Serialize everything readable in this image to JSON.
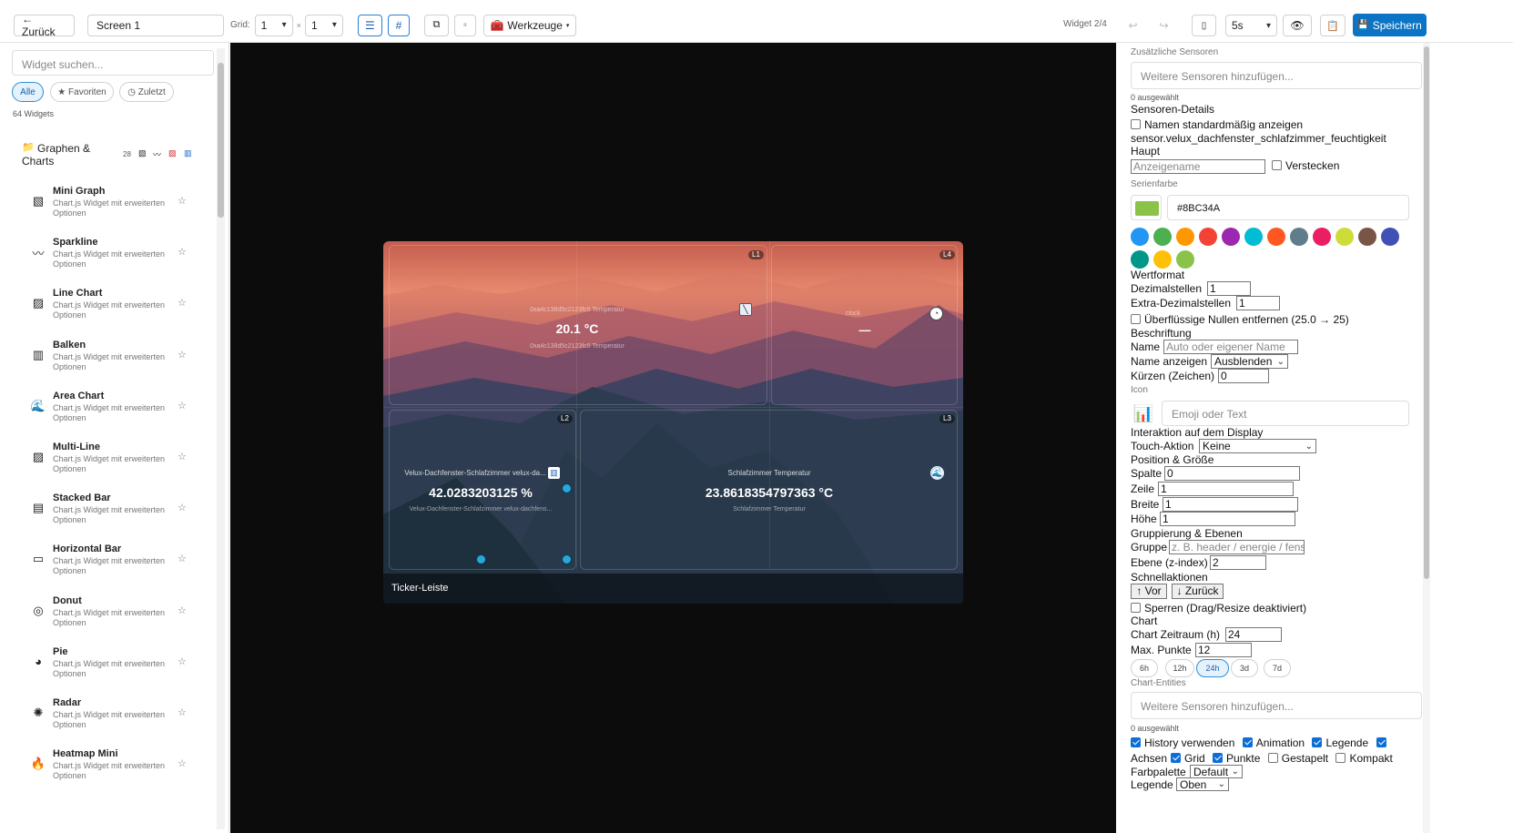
{
  "toolbar": {
    "back": "← Zurück",
    "screen_name": "Screen 1",
    "grid_label": "Grid:",
    "grid_cols": "1",
    "grid_x": "×",
    "grid_rows": "1",
    "tools": "Werkzeuge",
    "widget_counter": "Widget 2/4",
    "refresh": "5s",
    "save": "Speichern"
  },
  "sidebar": {
    "search_placeholder": "Widget suchen...",
    "filters": [
      "Alle",
      "★ Favoriten",
      "◷ Zuletzt"
    ],
    "count": "64 Widgets",
    "category": {
      "name": "Graphen & Charts",
      "count": "28"
    },
    "items": [
      {
        "name": "Mini Graph",
        "desc": "Chart.js Widget mit erweiterten Optionen",
        "icon": "mini-graph-icon"
      },
      {
        "name": "Sparkline",
        "desc": "Chart.js Widget mit erweiterten Optionen",
        "icon": "sparkline-icon"
      },
      {
        "name": "Line Chart",
        "desc": "Chart.js Widget mit erweiterten Optionen",
        "icon": "line-chart-icon"
      },
      {
        "name": "Balken",
        "desc": "Chart.js Widget mit erweiterten Optionen",
        "icon": "bar-chart-icon"
      },
      {
        "name": "Area Chart",
        "desc": "Chart.js Widget mit erweiterten Optionen",
        "icon": "wave-icon"
      },
      {
        "name": "Multi-Line",
        "desc": "Chart.js Widget mit erweiterten Optionen",
        "icon": "line-chart-icon"
      },
      {
        "name": "Stacked Bar",
        "desc": "Chart.js Widget mit erweiterten Optionen",
        "icon": "stacked-bar-icon"
      },
      {
        "name": "Horizontal Bar",
        "desc": "Chart.js Widget mit erweiterten Optionen",
        "icon": "horizontal-bar-icon"
      },
      {
        "name": "Donut",
        "desc": "Chart.js Widget mit erweiterten Optionen",
        "icon": "donut-icon"
      },
      {
        "name": "Pie",
        "desc": "Chart.js Widget mit erweiterten Optionen",
        "icon": "pie-icon"
      },
      {
        "name": "Radar",
        "desc": "Chart.js Widget mit erweiterten Optionen",
        "icon": "radar-icon"
      },
      {
        "name": "Heatmap Mini",
        "desc": "Chart.js Widget mit erweiterten Optionen",
        "icon": "flame-icon"
      }
    ]
  },
  "canvas": {
    "layers": [
      "L1",
      "L4",
      "L2",
      "L3"
    ],
    "w1": {
      "top": "0xa4c138d5c2123fc5 Temperatur",
      "value": "20.1 °C",
      "bottom": "0xa4c138d5c2123fc5 Temperatur"
    },
    "w2": {
      "label": "clock",
      "value": "—"
    },
    "w3": {
      "top": "Velux-Dachfenster-Schlafzimmer velux-da...",
      "value": "42.0283203125 %",
      "bottom": "Velux-Dachfenster-Schlafzimmer velux-dachfens..."
    },
    "w4": {
      "top": "Schlafzimmer Temperatur",
      "value": "23.8618354797363 °C",
      "bottom": "Schlafzimmer Temperatur"
    },
    "ticker": "Ticker-Leiste"
  },
  "panel": {
    "extra_sensors": "Zusätzliche Sensoren",
    "add_sensors_ph": "Weitere Sensoren hinzufügen...",
    "selected": "0 ausgewählt",
    "sensor_details": "Sensoren-Details",
    "show_names": "Namen standardmäßig anzeigen",
    "entity": "sensor.velux_dachfenster_schlafzimmer_feuchtigkeit",
    "main": "Haupt",
    "display_name_ph": "Anzeigename",
    "hide": "Verstecken",
    "series_color": "Serienfarbe",
    "color_hex": "#8BC34A",
    "palette": [
      "#2196F3",
      "#4CAF50",
      "#FF9800",
      "#F44336",
      "#9C27B0",
      "#00BCD4",
      "#FF5722",
      "#607D8B",
      "#E91E63",
      "#CDDC39",
      "#795548",
      "#3F51B5",
      "#009688",
      "#FFC107",
      "#8BC34A"
    ],
    "value_format": "Wertformat",
    "decimals_label": "Dezimalstellen",
    "decimals": "1",
    "extra_decimals_label": "Extra-Dezimalstellen",
    "extra_decimals": "1",
    "strip_zeros": "Überflüssige Nullen entfernen (25.0 → 25)",
    "caption": "Beschriftung",
    "name_label": "Name",
    "name_ph": "Auto oder eigener Name",
    "show_name_label": "Name anzeigen",
    "show_name": "Ausblenden",
    "shorten_label": "Kürzen (Zeichen)",
    "shorten": "0",
    "icon_label": "Icon",
    "icon_ph": "Emoji oder Text",
    "interaction": "Interaktion auf dem Display",
    "touch_label": "Touch-Aktion",
    "touch": "Keine",
    "pos_size": "Position & Größe",
    "col_label": "Spalte",
    "col": "0",
    "row_label": "Zeile",
    "row": "1",
    "width_label": "Breite",
    "width": "1",
    "height_label": "Höhe",
    "height": "1",
    "grouping": "Gruppierung & Ebenen",
    "group_label": "Gruppe",
    "group_ph": "z. B. header / energie / fenster",
    "layer_label": "Ebene (z-index)",
    "layer": "2",
    "quick": "Schnellaktionen",
    "forward": "↑ Vor",
    "backward": "↓ Zurück",
    "lock": "Sperren (Drag/Resize deaktiviert)",
    "chart": "Chart",
    "period_label": "Chart Zeitraum (h)",
    "period": "24",
    "max_points_label": "Max. Punkte",
    "max_points": "12",
    "ranges": [
      "6h",
      "12h",
      "24h",
      "3d",
      "7d"
    ],
    "entities": "Chart-Entities",
    "entities_ph": "Weitere Sensoren hinzufügen...",
    "entities_selected": "0 ausgewählt",
    "opts1": [
      "History verwenden",
      "Animation",
      "Legende"
    ],
    "opts2": [
      "Achsen",
      "Grid",
      "Punkte",
      "Gestapelt",
      "Kompakt"
    ],
    "palette_label": "Farbpalette",
    "palette_val": "Default",
    "legend_label": "Legende",
    "legend_val": "Oben"
  }
}
